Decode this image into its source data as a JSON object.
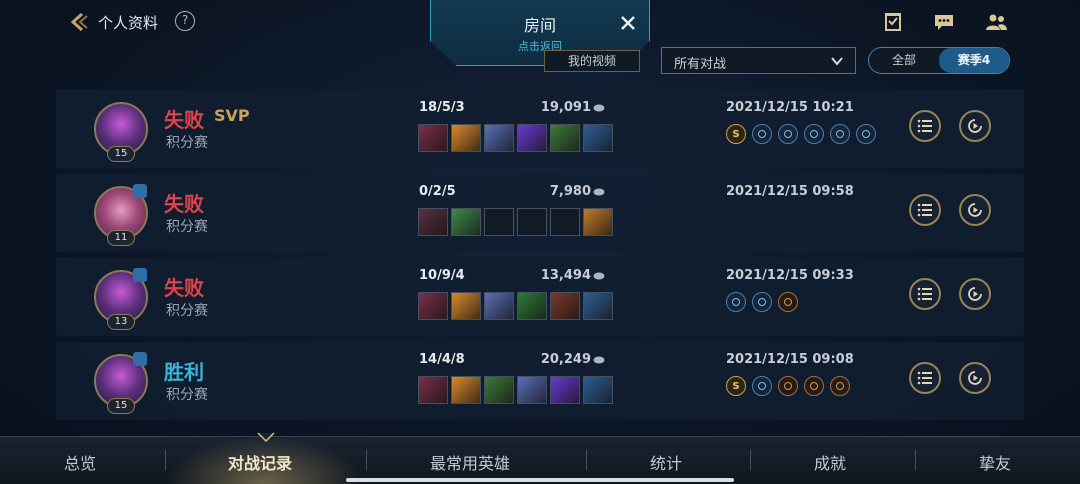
{
  "header": {
    "page_title": "个人资料",
    "help_label": "?",
    "room_title": "房间",
    "room_subtitle": "点击返回",
    "video_button": "我的视频",
    "filter_value": "所有对战",
    "season_options": [
      "全部",
      "赛季4"
    ],
    "season_active": "赛季4"
  },
  "matches": [
    {
      "result": "失败",
      "result_type": "lose",
      "svp": "SVP",
      "mode": "积分赛",
      "level": "15",
      "kda": "18/5/3",
      "gold": "19,091",
      "time": "2021/12/15 10:21",
      "items": 6,
      "badge_count": 6
    },
    {
      "result": "失败",
      "result_type": "lose",
      "svp": "",
      "mode": "积分赛",
      "level": "11",
      "kda": "0/2/5",
      "gold": "7,980",
      "time": "2021/12/15 09:58",
      "items": 6,
      "badge_count": 0
    },
    {
      "result": "失败",
      "result_type": "lose",
      "svp": "",
      "mode": "积分赛",
      "level": "13",
      "kda": "10/9/4",
      "gold": "13,494",
      "time": "2021/12/15 09:33",
      "items": 6,
      "badge_count": 3
    },
    {
      "result": "胜利",
      "result_type": "win",
      "svp": "",
      "mode": "积分赛",
      "level": "15",
      "kda": "14/4/8",
      "gold": "20,249",
      "time": "2021/12/15 09:08",
      "items": 6,
      "badge_count": 5
    }
  ],
  "bottom_nav": {
    "tabs": [
      "总览",
      "对战记录",
      "最常用英雄",
      "统计",
      "成就",
      "挚友"
    ],
    "active": "对战记录"
  },
  "colors": {
    "lose": "#e1424a",
    "win": "#3ab4d6",
    "svp": "#c9a25d",
    "accent_blue": "#2d9fc7"
  }
}
